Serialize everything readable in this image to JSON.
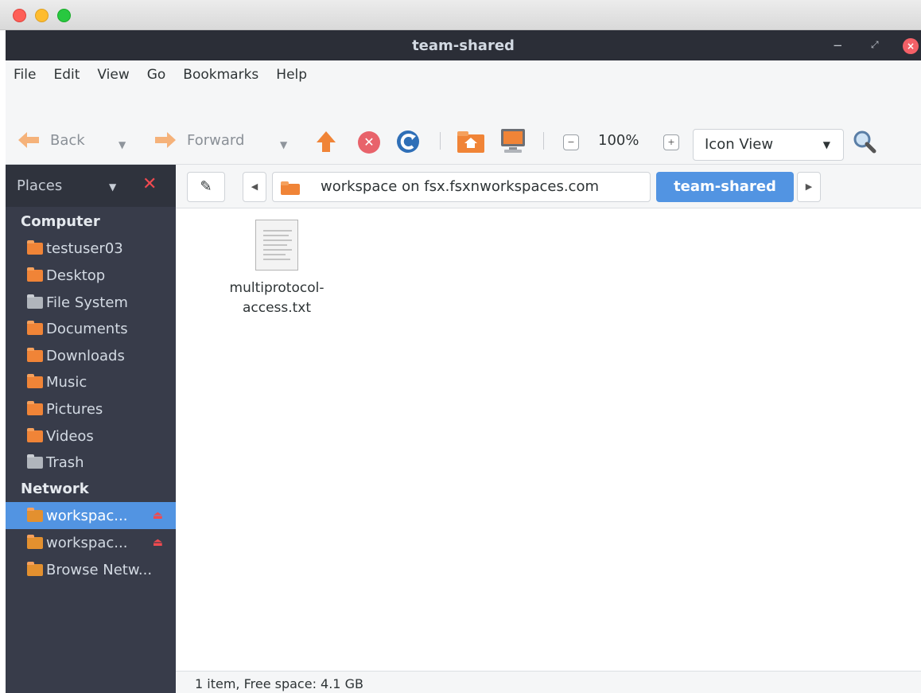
{
  "window": {
    "title": "team-shared",
    "close_glyph": "×"
  },
  "menu": [
    "File",
    "Edit",
    "View",
    "Go",
    "Bookmarks",
    "Help"
  ],
  "toolbar": {
    "back_label": "Back",
    "forward_label": "Forward",
    "zoom_level": "100%",
    "view_mode": "Icon View"
  },
  "sidebar": {
    "header": "Places",
    "sections": [
      {
        "title": "Computer",
        "items": [
          {
            "label": "testuser03",
            "icon": "home-folder-icon"
          },
          {
            "label": "Desktop",
            "icon": "desktop-folder-icon"
          },
          {
            "label": "File System",
            "icon": "file-system-icon"
          },
          {
            "label": "Documents",
            "icon": "documents-folder-icon"
          },
          {
            "label": "Downloads",
            "icon": "downloads-folder-icon"
          },
          {
            "label": "Music",
            "icon": "music-folder-icon"
          },
          {
            "label": "Pictures",
            "icon": "pictures-folder-icon"
          },
          {
            "label": "Videos",
            "icon": "videos-folder-icon"
          },
          {
            "label": "Trash",
            "icon": "trash-icon"
          }
        ]
      },
      {
        "title": "Network",
        "items": [
          {
            "label": "workspac...",
            "icon": "network-share-icon",
            "active": true
          },
          {
            "label": "workspac...",
            "icon": "network-share-icon"
          },
          {
            "label": "Browse Netw...",
            "icon": "browse-network-icon"
          }
        ]
      }
    ]
  },
  "location": {
    "parent": "workspace on fsx.fsxnworkspaces.com",
    "current": "team-shared"
  },
  "files": [
    {
      "name_line1": "multiprotocol-",
      "name_line2": "access.txt",
      "icon": "text-file-icon"
    }
  ],
  "status": "1 item, Free space: 4.1 GB",
  "colors": {
    "accent": "#5294e2",
    "sidebar_bg": "#383c4a",
    "titlebar_bg": "#2b2e37",
    "eject": "#f04a50"
  }
}
